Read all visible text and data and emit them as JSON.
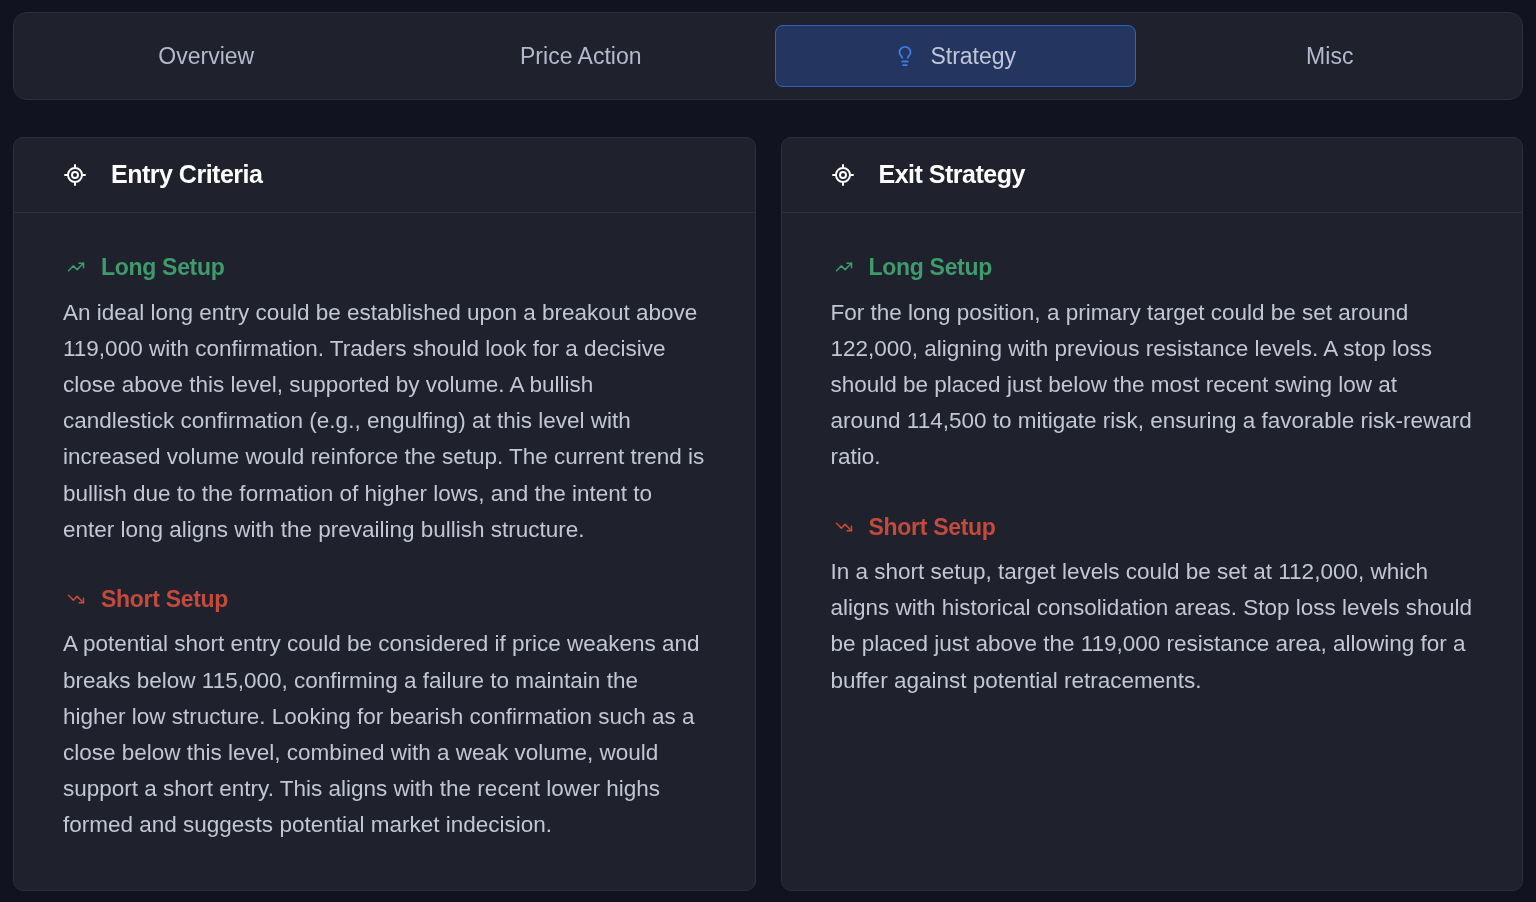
{
  "tabs": [
    {
      "label": "Overview",
      "selected": false
    },
    {
      "label": "Price Action",
      "selected": false
    },
    {
      "label": "Strategy",
      "selected": true
    },
    {
      "label": "Misc",
      "selected": false
    }
  ],
  "cards": [
    {
      "title": "Entry Criteria",
      "sections": [
        {
          "kind": "long",
          "heading": "Long Setup",
          "text": "An ideal long entry could be established upon a breakout above 119,000 with confirmation. Traders should look for a decisive close above this level, supported by volume. A bullish candlestick confirmation (e.g., engulfing) at this level with increased volume would reinforce the setup. The current trend is bullish due to the formation of higher lows, and the intent to enter long aligns with the prevailing bullish structure."
        },
        {
          "kind": "short",
          "heading": "Short Setup",
          "text": "A potential short entry could be considered if price weakens and breaks below 115,000, confirming a failure to maintain the higher low structure. Looking for bearish confirmation such as a close below this level, combined with a weak volume, would support a short entry. This aligns with the recent lower highs formed and suggests potential market indecision."
        }
      ]
    },
    {
      "title": "Exit Strategy",
      "sections": [
        {
          "kind": "long",
          "heading": "Long Setup",
          "text": "For the long position, a primary target could be set around 122,000, aligning with previous resistance levels. A stop loss should be placed just below the most recent swing low at around 114,500 to mitigate risk, ensuring a favorable risk-reward ratio."
        },
        {
          "kind": "short",
          "heading": "Short Setup",
          "text": "In a short setup, target levels could be set at 112,000, which aligns with historical consolidation areas. Stop loss levels should be placed just above the 119,000 resistance area, allowing for a buffer against potential retracements."
        }
      ]
    }
  ]
}
